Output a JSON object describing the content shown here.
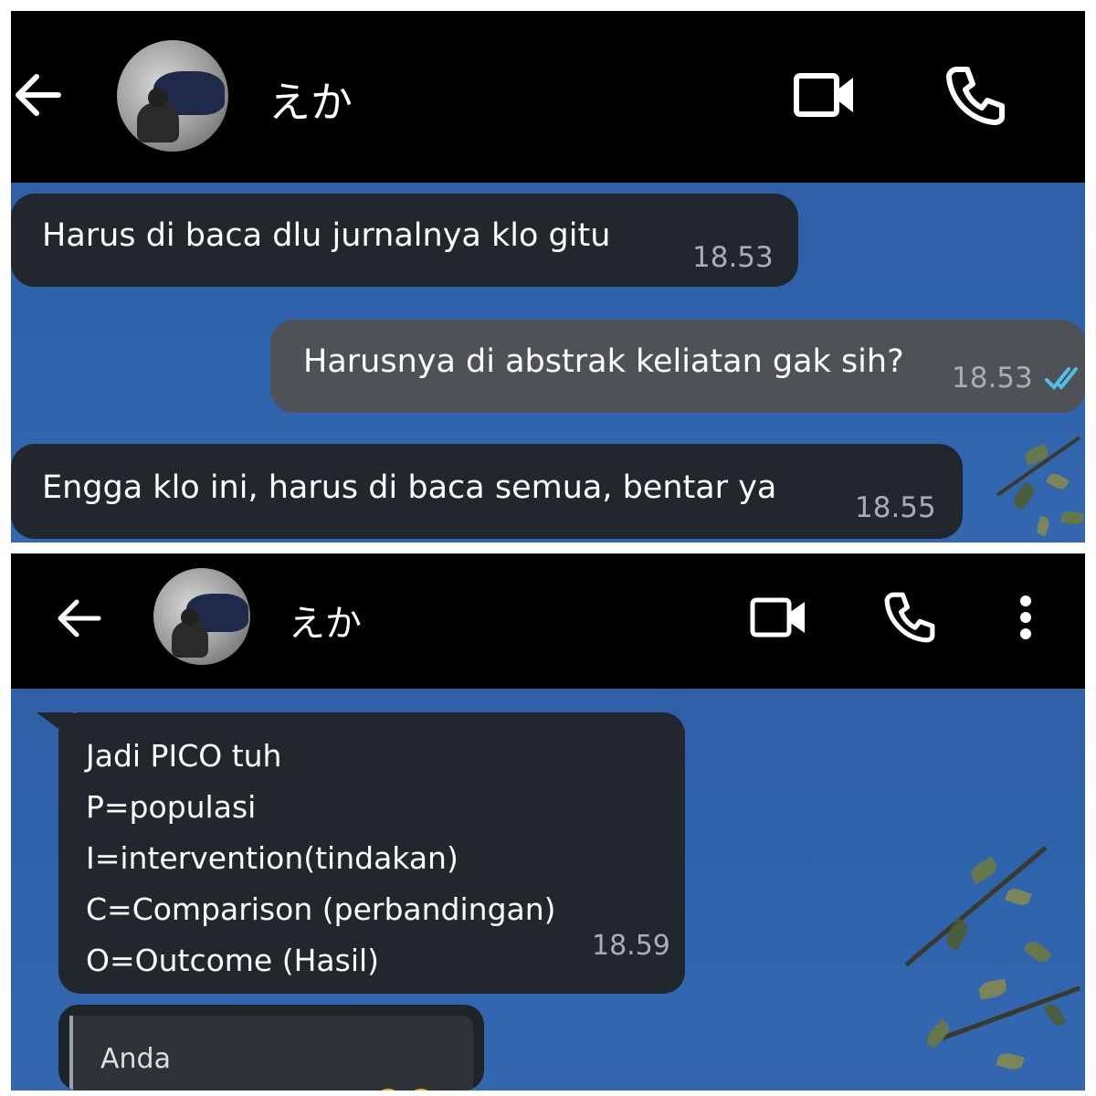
{
  "colors": {
    "header_bg": "#000000",
    "chat_bg": "#2e63ad",
    "incoming_bubble": "#22272d",
    "outgoing_bubble": "#4e5257",
    "timestamp": "#a9aeb4",
    "read_ticks": "#53bdeb"
  },
  "top_panel": {
    "header": {
      "contact_name": "えか",
      "icons": [
        "back-arrow-icon",
        "video-call-icon",
        "voice-call-icon"
      ]
    },
    "messages": [
      {
        "direction": "incoming",
        "text": "Harus di baca dlu jurnalnya klo gitu",
        "time": "18.53"
      },
      {
        "direction": "outgoing",
        "text": "Harusnya di abstrak keliatan gak sih?",
        "time": "18.53",
        "status": "read"
      },
      {
        "direction": "incoming",
        "text": "Engga klo ini, harus di baca semua, bentar ya",
        "time": "18.55"
      }
    ]
  },
  "bottom_panel": {
    "header": {
      "contact_name": "えか",
      "icons": [
        "back-arrow-icon",
        "video-call-icon",
        "voice-call-icon",
        "more-options-icon"
      ]
    },
    "messages": [
      {
        "direction": "incoming",
        "lines": [
          "Jadi PICO tuh",
          "P=populasi",
          "I=intervention(tindakan)",
          "C=Comparison (perbandingan)",
          "O=Outcome (Hasil)"
        ],
        "time": "18.59"
      }
    ],
    "reply_preview": {
      "sender": "Anda"
    }
  }
}
